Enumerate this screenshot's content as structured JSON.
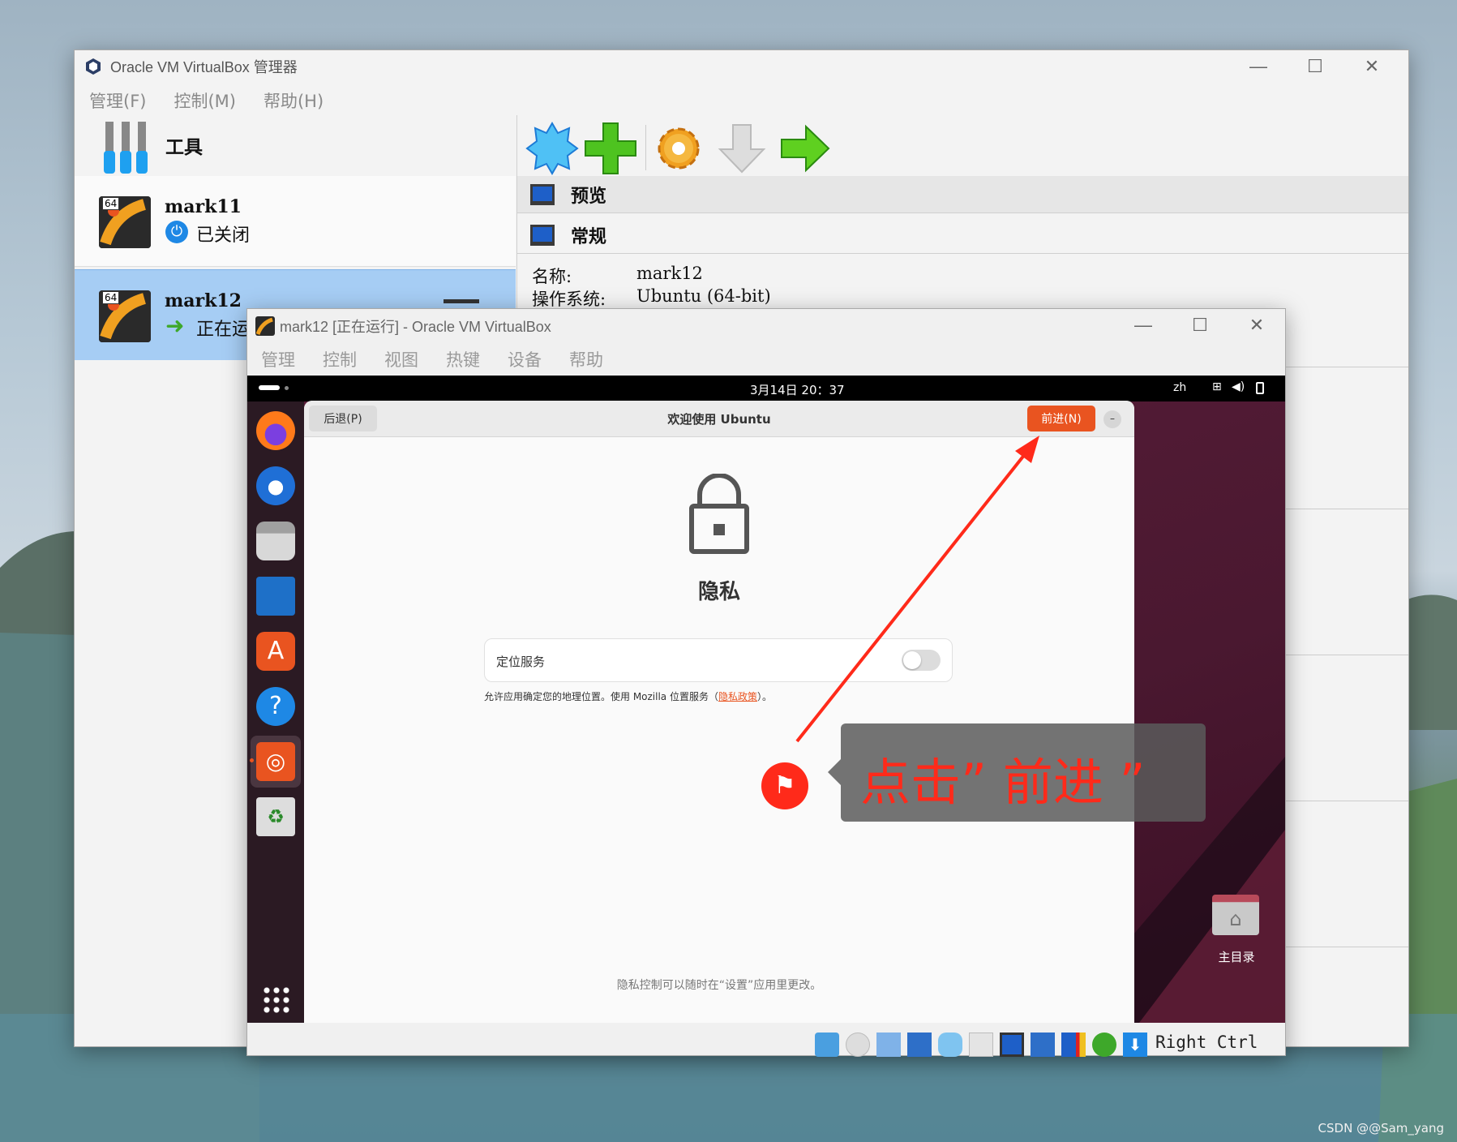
{
  "manager": {
    "title": "Oracle VM VirtualBox 管理器",
    "menu": [
      "管理(F)",
      "控制(M)",
      "帮助(H)"
    ],
    "tools_label": "工具",
    "vms": [
      {
        "name": "mark11",
        "state": "已关闭",
        "badge": "64"
      },
      {
        "name": "mark12",
        "state": "正在运行",
        "badge": "64"
      }
    ],
    "sections": {
      "preview": "预览",
      "general": "常规"
    },
    "details": [
      {
        "label": "名称:",
        "value": "mark12"
      },
      {
        "label": "操作系统:",
        "value": "Ubuntu (64-bit)"
      }
    ]
  },
  "vmwindow": {
    "title": "mark12 [正在运行] - Oracle VM VirtualBox",
    "menu": [
      "管理",
      "控制",
      "视图",
      "热键",
      "设备",
      "帮助"
    ],
    "hostkey": "Right Ctrl"
  },
  "ubuntu": {
    "topbar": {
      "datetime": "3月14日 20：37",
      "lang": "zh"
    },
    "dialog": {
      "title": "欢迎使用 Ubuntu",
      "back": "后退(P)",
      "next": "前进(N)",
      "heading": "隐私",
      "location_label": "定位服务",
      "location_enabled": false,
      "desc_prefix": "允许应用确定您的地理位置。使用 Mozilla 位置服务（",
      "desc_link": "隐私政策",
      "desc_suffix": "）。",
      "footer": "隐私控制可以随时在“设置”应用里更改。"
    },
    "desktop_home": "主目录"
  },
  "annotation": {
    "text": "点击” 前进 ”"
  },
  "watermark": "CSDN @@Sam_yang",
  "colors": {
    "accent": "#e95420",
    "annotation": "#ff2a1a",
    "selected": "#a6cdf4"
  }
}
